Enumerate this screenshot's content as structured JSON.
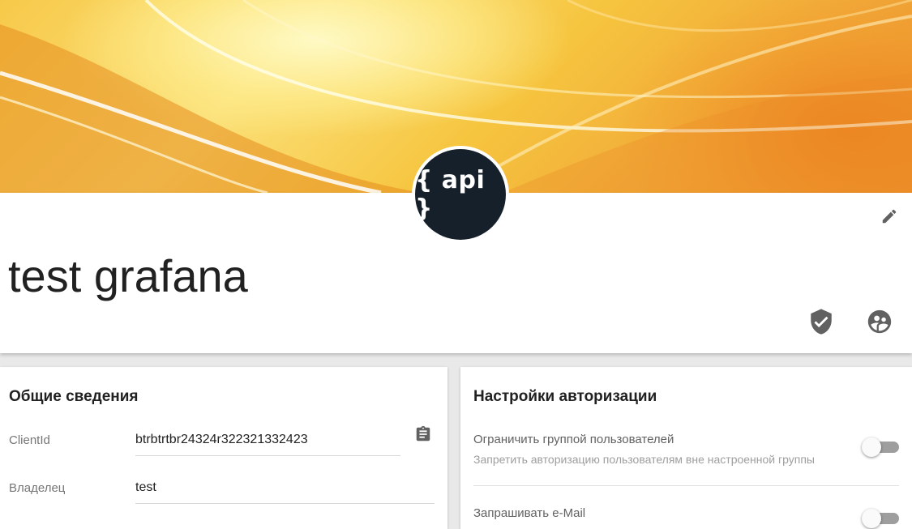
{
  "app": {
    "title": "test grafana",
    "avatar_text": "{ api }",
    "avatar_bg": "#16202a"
  },
  "header": {
    "edit_icon": "pencil-icon",
    "verified_icon": "shield-check-icon",
    "groups_icon": "account-group-icon"
  },
  "general": {
    "title": "Общие сведения",
    "client_id_label": "ClientId",
    "client_id_value": "btrbtrtbr24324r322321332423",
    "copy_icon": "clipboard-icon",
    "owner_label": "Владелец",
    "owner_value": "test"
  },
  "auth": {
    "title": "Настройки авторизации",
    "restrict_group_title": "Ограничить группой пользователей",
    "restrict_group_desc": "Запретить авторизацию пользователям вне настроенной группы",
    "restrict_group_enabled": false,
    "request_email_title": "Запрашивать e-Mail",
    "request_email_enabled": false
  },
  "colors": {
    "banner_accent": "#f6c53f",
    "banner_deep": "#ec902c",
    "icon_gray": "#616161"
  }
}
